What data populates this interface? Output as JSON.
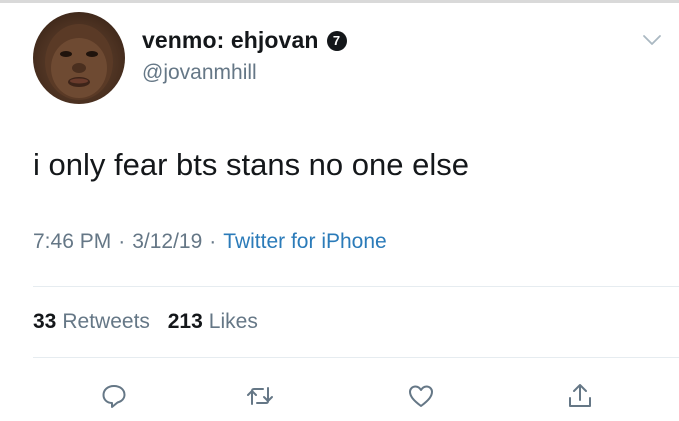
{
  "tweet": {
    "display_name": "venmo: ehjovan",
    "verified_badge_glyph": "7",
    "handle": "@jovanmhill",
    "text": "i only fear bts stans no one else",
    "time": "7:46 PM",
    "date": "3/12/19",
    "separator": "·",
    "source": "Twitter for iPhone",
    "retweets_count": "33",
    "retweets_label": "Retweets",
    "likes_count": "213",
    "likes_label": "Likes"
  },
  "icons": {
    "avatar": "profile-photo",
    "badge": "verified-badge-icon",
    "caret": "chevron-down-icon",
    "reply": "reply-icon",
    "retweet": "retweet-icon",
    "like": "heart-icon",
    "share": "share-icon"
  },
  "colors": {
    "text": "#14171a",
    "secondary": "#657786",
    "link": "#2b7bb9",
    "divider": "#e6ecf0"
  }
}
